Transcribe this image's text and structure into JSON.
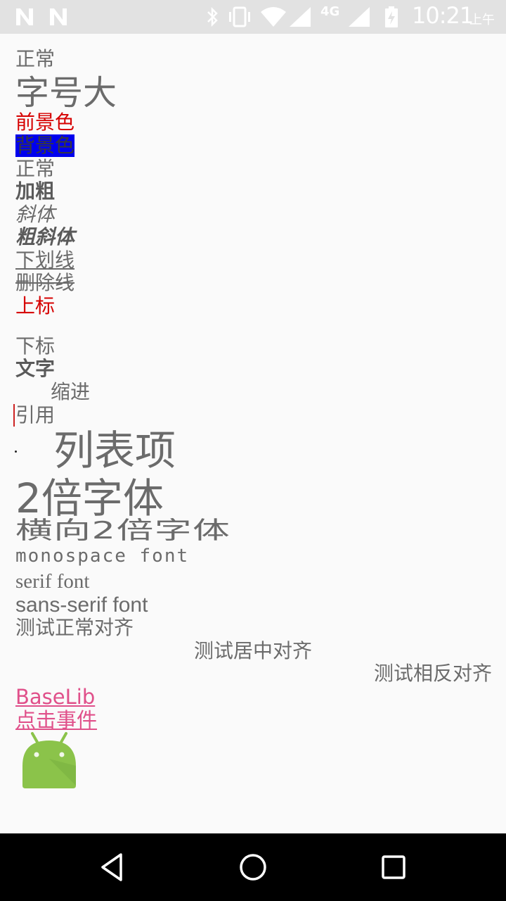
{
  "status_bar": {
    "time": "10:21",
    "ampm": "上午",
    "network_label": "4G",
    "icons": [
      "notification-n-icon",
      "notification-n-icon",
      "bluetooth-icon",
      "vibrate-icon",
      "wifi-icon",
      "signal-icon",
      "signal-icon",
      "battery-charging-icon"
    ]
  },
  "content": {
    "normal1": "正常",
    "large_size": "字号大",
    "foreground_color": "前景色",
    "background_color": "背景色",
    "normal2": "正常",
    "bold": "加粗",
    "italic": "斜体",
    "bold_italic": "粗斜体",
    "underline": "下划线",
    "strikethrough": "删除线",
    "superscript": "上标",
    "subscript": "下标",
    "text": "文字",
    "indent": "缩进",
    "quote": "引用",
    "list_item": "列表项",
    "double_font": "2倍字体",
    "horizontal_double_font": "横向2倍字体",
    "monospace_font": "monospace font",
    "serif_font": "serif font",
    "sans_serif_font": "sans-serif font",
    "align_normal": "测试正常对齐",
    "align_center": "测试居中对齐",
    "align_opposite": "测试相反对齐",
    "link_baselib": "BaseLib",
    "link_click_event": "点击事件",
    "image_icon": "android-robot-icon"
  },
  "colors": {
    "foreground_red": "#d60000",
    "background_blue": "#0000ee",
    "link_pink": "#e0508a",
    "android_green": "#8bc34a"
  },
  "nav_bar": {
    "icons": [
      "back-icon",
      "home-icon",
      "recents-icon"
    ]
  }
}
